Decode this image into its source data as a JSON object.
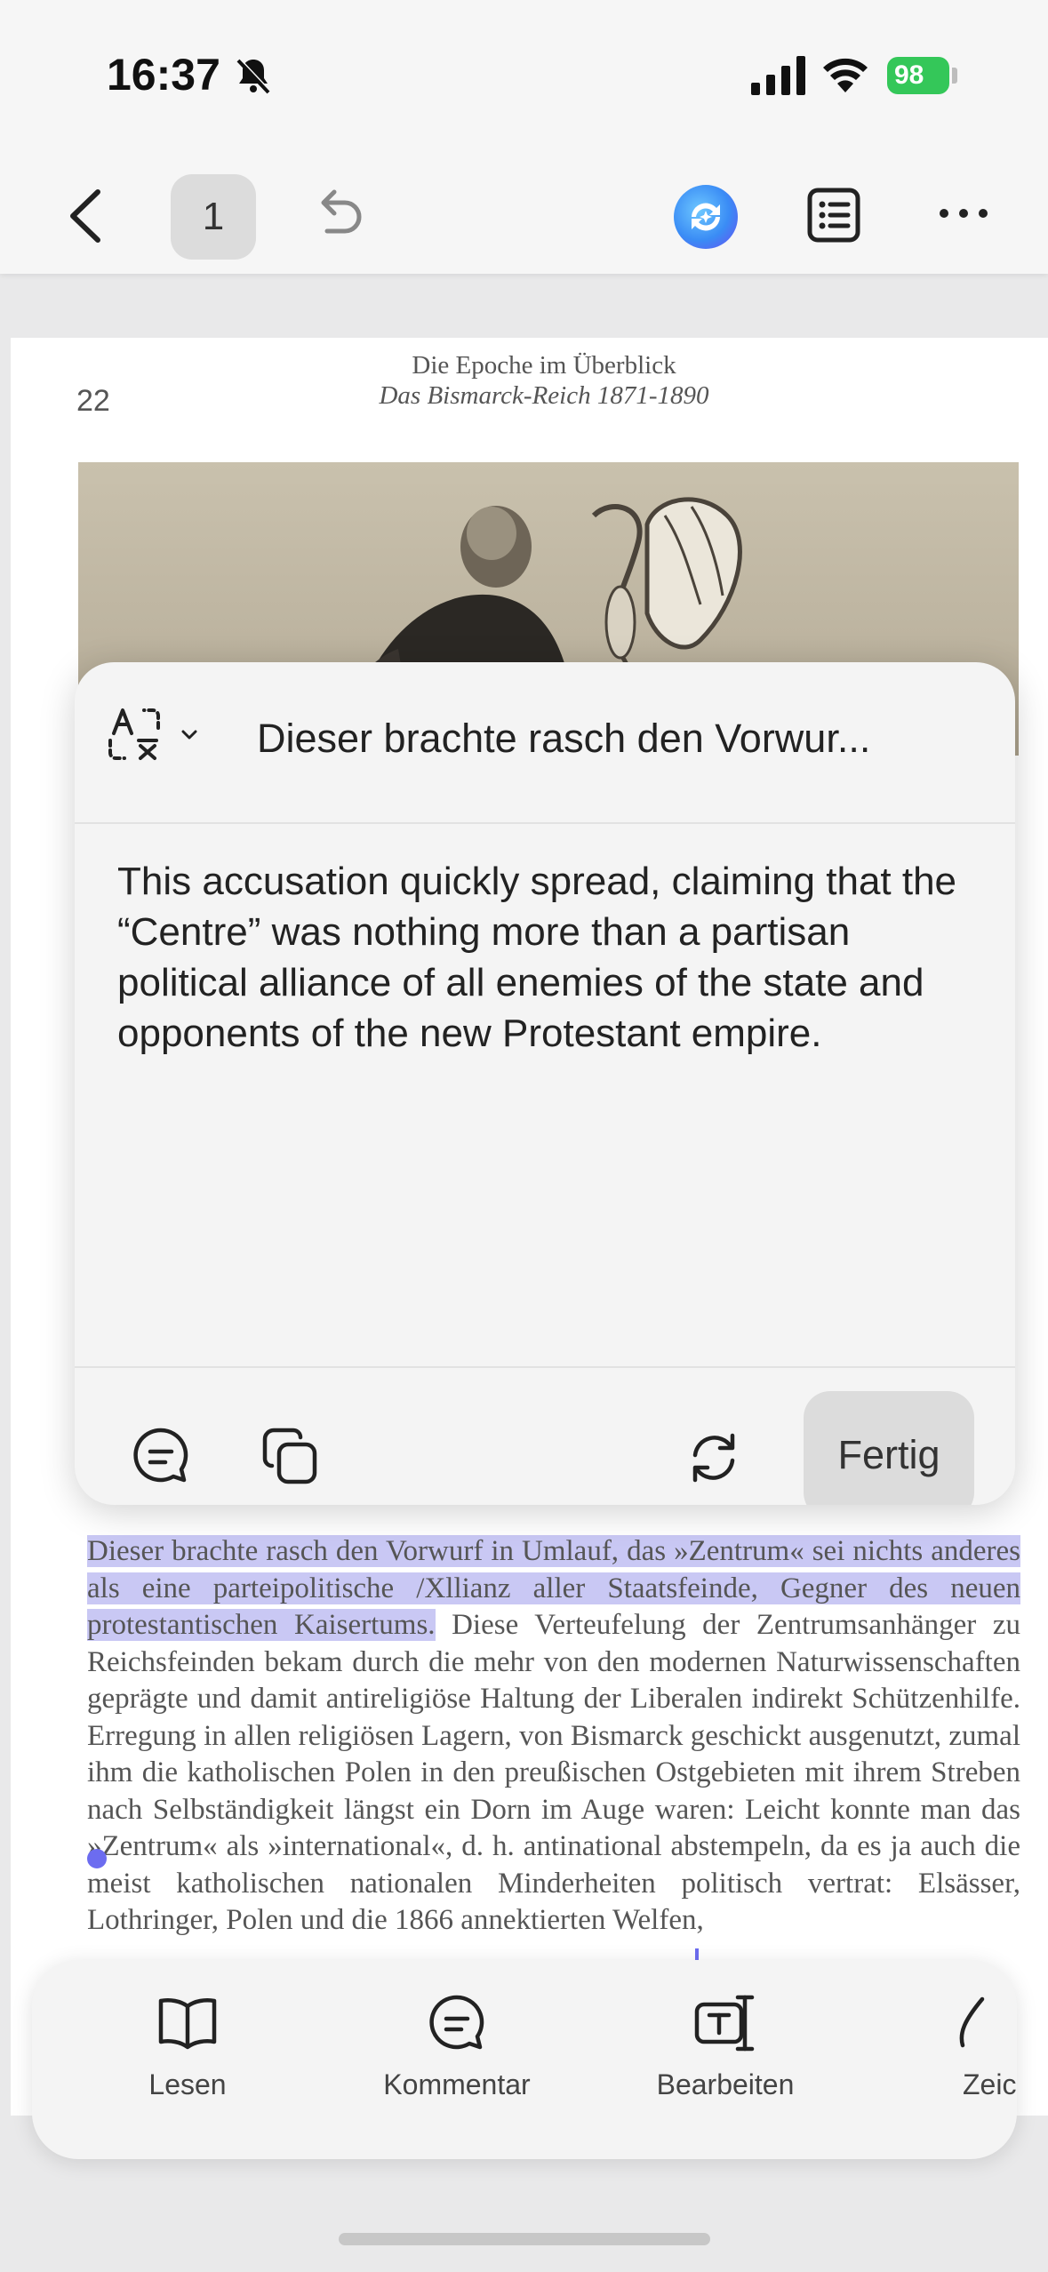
{
  "status_bar": {
    "time": "16:37",
    "battery": "98"
  },
  "toolbar": {
    "page_number": "1"
  },
  "document": {
    "page_number": "22",
    "running_title": "Die Epoche im Überblick",
    "running_subtitle": "Das Bismarck-Reich 1871-1890",
    "highlighted_text": "Dieser brachte rasch den Vorwurf in Umlauf, das »Zentrum« sei nichts anderes als eine parteipolitische /Xllianz aller Staatsfeinde, Gegner des neuen protestantischen Kaisertums.",
    "body_text": " Diese Verteufelung der Zentrumsanhänger zu Reichsfeinden bekam durch die mehr von den modernen Naturwissenschaften geprägte und damit antireligiöse Haltung der Liberalen indirekt Schützenhilfe. Erregung in allen religiösen Lagern, von Bismarck geschickt ausgenutzt, zumal ihm die katholischen Polen in den preußischen Ostgebieten mit ihrem Streben nach Selbständigkeit längst ein Dorn im Auge waren: Leicht konnte man das »Zentrum« als »international«, d. h. antinational abstempeln, da es ja auch die meist katholischen nationalen Minderheiten politisch vertrat: Elsässer, Lothringer, Polen und die 1866 annektierten Welfen,"
  },
  "translation_popover": {
    "source_text": "Dieser brachte rasch den Vorwur...",
    "translation": "This accusation quickly spread, claiming that the “Centre” was nothing more than a partisan political alliance of all enemies of the state and opponents of the new Protestant empire.",
    "done_label": "Fertig"
  },
  "bottom_bar": {
    "tabs": [
      {
        "label": "Lesen",
        "icon": "book-icon"
      },
      {
        "label": "Kommentar",
        "icon": "comment-icon"
      },
      {
        "label": "Bearbeiten",
        "icon": "edit-text-icon"
      },
      {
        "label": "Zeic",
        "icon": "draw-icon"
      }
    ]
  },
  "colors": {
    "selection": "#c9c8f4",
    "selection_handle": "#6c6cf0",
    "battery": "#34c759"
  }
}
